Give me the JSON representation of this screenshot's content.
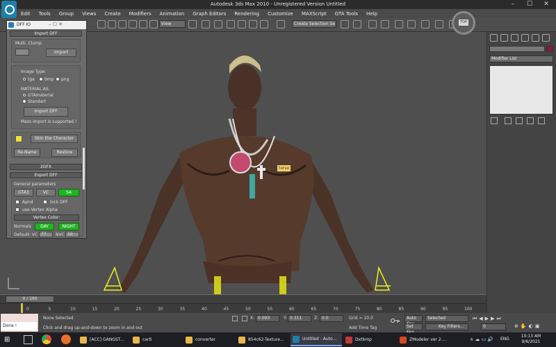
{
  "window": {
    "title": "Autodesk 3ds Max  2010  - Unregistered Version      Untitled",
    "controls": [
      "–",
      "☐",
      "✕"
    ]
  },
  "menubar": [
    "Edit",
    "Tools",
    "Group",
    "Views",
    "Create",
    "Modifiers",
    "Animation",
    "Graph Editors",
    "Rendering",
    "Customize",
    "MAXScript",
    "GTA Tools",
    "Help"
  ],
  "toolbar": {
    "view_dropdown": "View",
    "selection_set": "Create Selection Se"
  },
  "viewport": {
    "object_label": "torso",
    "nav_cube_label": "TOP"
  },
  "dff_panel": {
    "title": "DFF IO",
    "import_rollout": "Import DFF",
    "multi_clump_label": "Multi. Clump",
    "import_button": "Import",
    "image_type_label": "Image Type:",
    "image_types": [
      "tga",
      "bmp",
      "png"
    ],
    "material_as_label": "MATERIAL AS:",
    "materials": [
      "GTAmaterial",
      "Standart"
    ],
    "import_dff_button": "Import DFF",
    "mass_import_note": "Mass import is supported !",
    "skin_button": "Skin the Character",
    "rename_button": "Re-Name",
    "restore_button": "Restore",
    "twodfx_rollout": "2DFX",
    "export_rollout": "Export DFF",
    "general_params_label": "General parameters",
    "versions": [
      "GTA3",
      "VC",
      "SA"
    ],
    "apnd_label": "Apnd",
    "lock_dff_label": "lock DFF",
    "vertex_alpha_label": "use Vertex Alpha",
    "vertex_color_label": "Vertex Color:",
    "normals_label": "Normals",
    "day_button": "DAY",
    "night_button": "NIGHT",
    "default_vc_label": "Default: VC",
    "default_vc_value": "77",
    "nvc_label": "NVC",
    "nvc_value": "10"
  },
  "command_panel": {
    "modifier_list": "Modifier List"
  },
  "timeline": {
    "position": "0 / 100",
    "ticks": [
      "0",
      "5",
      "10",
      "15",
      "20",
      "25",
      "30",
      "35",
      "40",
      "45",
      "50",
      "55",
      "60",
      "65",
      "70",
      "75",
      "80",
      "85",
      "90",
      "95",
      "100"
    ]
  },
  "status": {
    "maxscript_output": "Done !",
    "selection": "None Selected",
    "prompt": "Click and drag up-and-down to zoom in and out",
    "x_label": "X:",
    "x_value": "0.093",
    "y_label": "Y:",
    "y_value": "0.311",
    "z_label": "Z:",
    "z_value": "0.0",
    "grid": "Grid = 10.0",
    "add_time_tag": "Add Time Tag",
    "auto_key": "Auto Key",
    "key_mode": "Selected",
    "set_key": "Set Key",
    "key_filters": "Key Filters...",
    "frame_value": "0"
  },
  "taskbar": {
    "items": [
      {
        "label": "[ACC] GANGST...",
        "color": "#e8b84a"
      },
      {
        "label": "carti",
        "color": "#e8b84a"
      },
      {
        "label": "converter",
        "color": "#e8b84a"
      },
      {
        "label": "854c62-Texture...",
        "color": "#e8b84a"
      },
      {
        "label": "Untitled - Auto...",
        "color": "#1e7fa8"
      },
      {
        "label": "Dxtbmp",
        "color": "#c23a3a"
      },
      {
        "label": "ZModeler ver 2....",
        "color": "#d84a1e"
      }
    ],
    "lang": "ENG",
    "time": "10:13 AM",
    "date": "9/6/2021"
  }
}
